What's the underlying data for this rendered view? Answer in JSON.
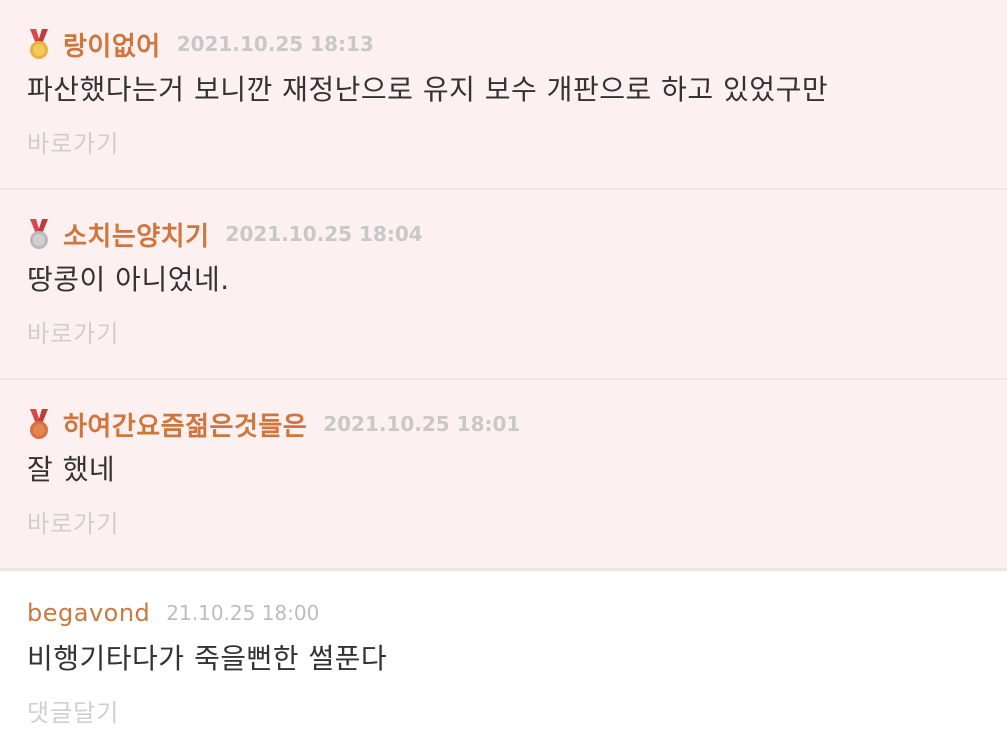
{
  "comments": [
    {
      "rank": "gold",
      "nickname": "랑이없어",
      "date": "2021.10.25 18:13",
      "content": "파산했다는거 보니깐 재정난으로 유지 보수 개판으로 하고 있었구만",
      "link_label": "바로가기"
    },
    {
      "rank": "silver",
      "nickname": "소치는양치기",
      "date": "2021.10.25 18:04",
      "content": "땅콩이 아니었네.",
      "link_label": "바로가기"
    },
    {
      "rank": "bronze",
      "nickname": "하여간요즘젊은것들은",
      "date": "2021.10.25 18:01",
      "content": "잘 했네",
      "link_label": "바로가기"
    },
    {
      "nickname": "begavond",
      "date": "21.10.25 18:00",
      "content": "비행기타다가 죽을뻔한 썰푼다",
      "link_label": "댓글달기"
    }
  ],
  "colors": {
    "best_background": "#fcf0f0",
    "nickname": "#d0763c",
    "gold": "#e8b33a",
    "silver": "#b9b9b9",
    "bronze": "#d9703f",
    "ribbon": "#d8474a"
  },
  "icons": {
    "gold": "gold-medal-icon",
    "silver": "silver-medal-icon",
    "bronze": "bronze-medal-icon"
  }
}
